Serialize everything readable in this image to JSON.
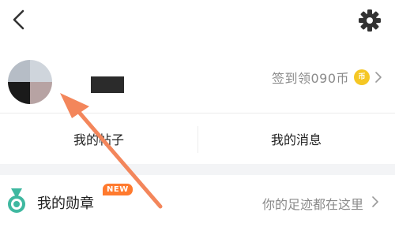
{
  "topbar": {
    "back_icon": "chevron-left-icon",
    "settings_icon": "gear-icon"
  },
  "profile": {
    "signin_text": "签到领090币",
    "coin_icon": "coin-icon",
    "coin_glyph": "币"
  },
  "tabs": [
    {
      "label": "我的帖子"
    },
    {
      "label": "我的消息"
    }
  ],
  "medal_row": {
    "label": "我的勋章",
    "badge": "NEW",
    "subtitle": "你的足迹都在这里",
    "icon": "medal-icon"
  },
  "colors": {
    "accent_orange": "#ff7a2e",
    "coin_yellow": "#f5c724",
    "medal_teal": "#3fb8a0",
    "annotation_arrow": "#f3865b"
  }
}
